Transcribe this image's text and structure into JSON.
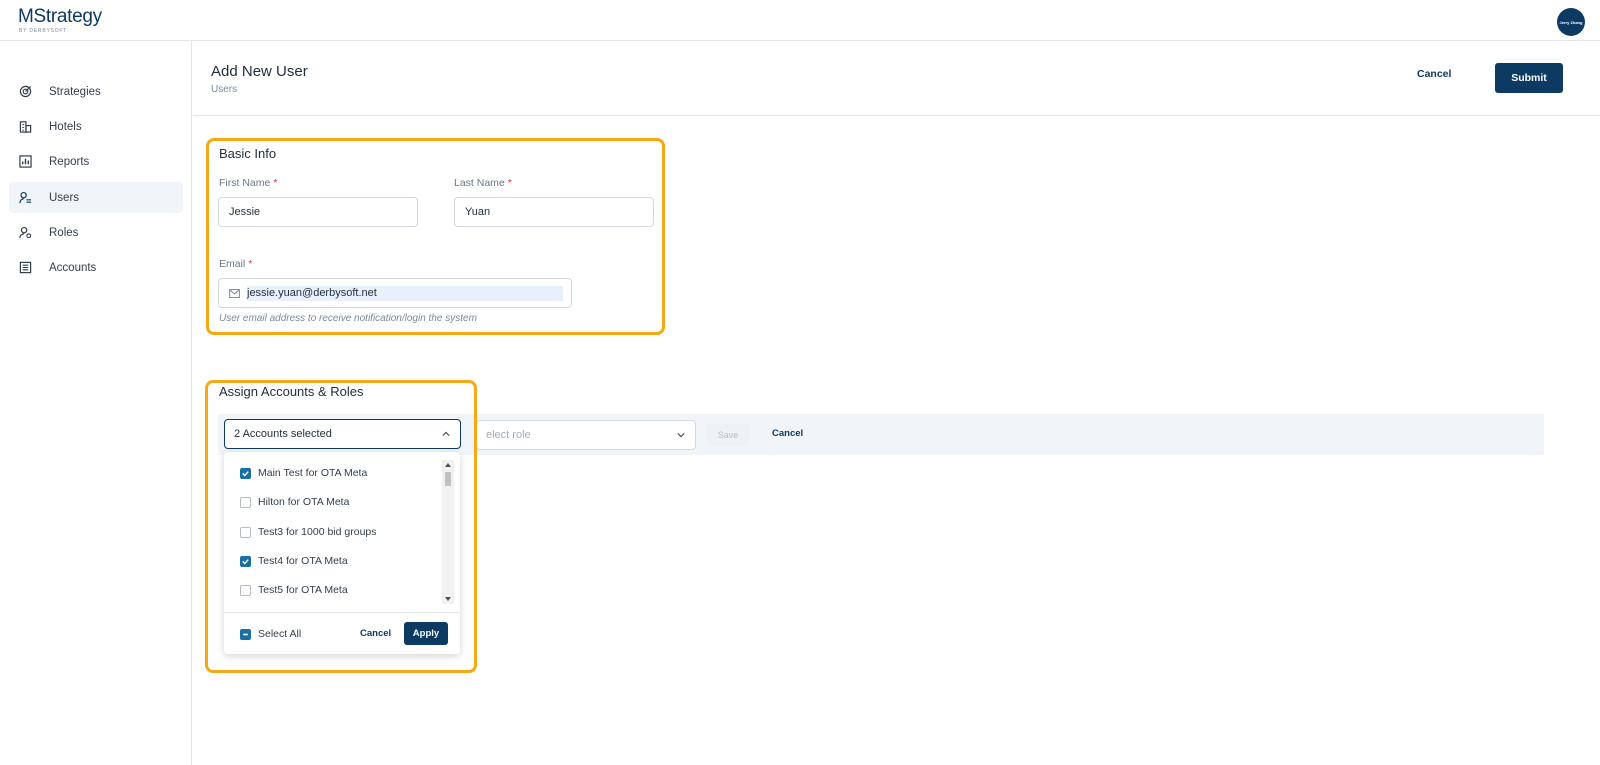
{
  "app": {
    "logo_main": "MStrategy",
    "logo_sub": "BY DERBYSOFT",
    "avatar_text": "Jerry Zhang"
  },
  "sidebar": {
    "items": [
      {
        "label": "Strategies",
        "icon": "target-icon",
        "active": false
      },
      {
        "label": "Hotels",
        "icon": "building-icon",
        "active": false
      },
      {
        "label": "Reports",
        "icon": "bar-chart-icon",
        "active": false
      },
      {
        "label": "Users",
        "icon": "user-list-icon",
        "active": true
      },
      {
        "label": "Roles",
        "icon": "user-gear-icon",
        "active": false
      },
      {
        "label": "Accounts",
        "icon": "ledger-icon",
        "active": false
      }
    ]
  },
  "header": {
    "title": "Add New User",
    "breadcrumb": "Users",
    "cancel_label": "Cancel",
    "submit_label": "Submit"
  },
  "basic_info": {
    "title": "Basic Info",
    "first_name_label": "First Name",
    "first_name_value": "Jessie",
    "last_name_label": "Last Name",
    "last_name_value": "Yuan",
    "email_label": "Email",
    "email_value": "jessie.yuan@derbysoft.net",
    "email_helper": "User email address to receive notification/login the system",
    "required_mark": "*"
  },
  "assign": {
    "title": "Assign Accounts & Roles",
    "accounts_select_value": "2 Accounts selected",
    "role_placeholder": "elect role",
    "save_label": "Save",
    "cancel_label": "Cancel"
  },
  "accounts_dropdown": {
    "options": [
      {
        "label": "Main Test for OTA Meta",
        "checked": true
      },
      {
        "label": "Hilton for OTA Meta",
        "checked": false
      },
      {
        "label": "Test3 for 1000 bid groups",
        "checked": false
      },
      {
        "label": "Test4 for OTA Meta",
        "checked": true
      },
      {
        "label": "Test5 for OTA Meta",
        "checked": false
      }
    ],
    "select_all_label": "Select All",
    "cancel_label": "Cancel",
    "apply_label": "Apply"
  },
  "colors": {
    "brand": "#0d3a63",
    "highlight": "#f5a916",
    "checkbox": "#1c6fa3"
  }
}
